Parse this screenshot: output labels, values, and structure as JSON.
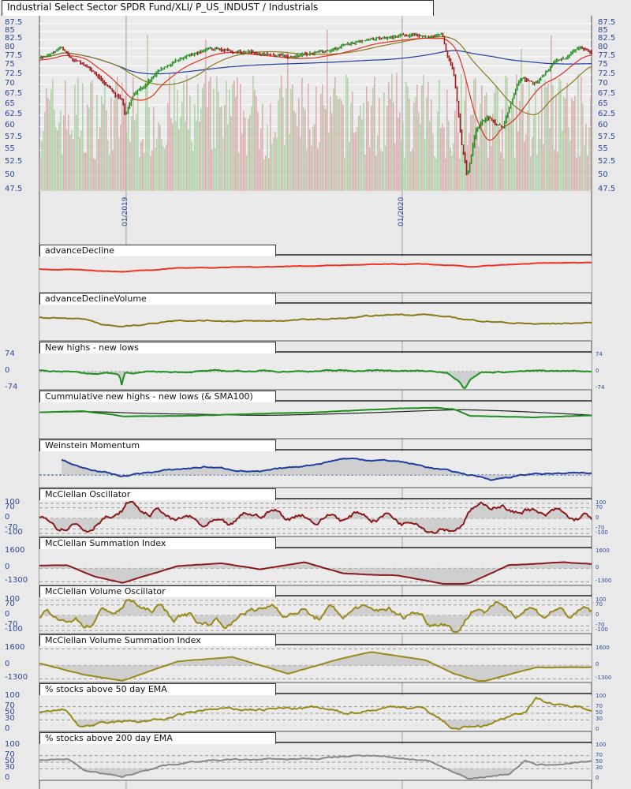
{
  "header": {
    "title": "Industrial Select Sector SPDR Fund/XLI/ P_US_INDUST / Industrials"
  },
  "colors": {
    "up": "#1f8f1f",
    "down": "#9b1b1b",
    "sma_fast": "#e03020",
    "sma_slow": "#1f3fa0",
    "sma_mid": "#8a7a20",
    "axis_text": "#2a4a9a"
  },
  "chart_data": [
    {
      "type": "candlestick",
      "title": "Industrial Select Sector SPDR Fund/XLI/ P_US_INDUST / Industrials",
      "x_index_range": [
        0,
        100
      ],
      "date_ticks": [
        {
          "t": 15.7,
          "label": "01/2019"
        },
        {
          "t": 65.7,
          "label": "01/2020"
        }
      ],
      "yticks": [
        "87.5",
        "85",
        "82.5",
        "80",
        "77.5",
        "75",
        "72.5",
        "70",
        "67.5",
        "65",
        "62.5",
        "60",
        "57.5",
        "55",
        "52.5",
        "50",
        "47.5"
      ],
      "ylim": [
        47.5,
        87.5
      ],
      "scale": "log",
      "close": [
        [
          0,
          77
        ],
        [
          4,
          80
        ],
        [
          6,
          76
        ],
        [
          8,
          75
        ],
        [
          11,
          72
        ],
        [
          15,
          66
        ],
        [
          15.5,
          62
        ],
        [
          17,
          67
        ],
        [
          20,
          71
        ],
        [
          23,
          75
        ],
        [
          27,
          78
        ],
        [
          31,
          80
        ],
        [
          36,
          79
        ],
        [
          40,
          78
        ],
        [
          46,
          77
        ],
        [
          50,
          79
        ],
        [
          54,
          80
        ],
        [
          58,
          82
        ],
        [
          64,
          83
        ],
        [
          68,
          84
        ],
        [
          73,
          84
        ],
        [
          73.5,
          80
        ],
        [
          75,
          73
        ],
        [
          76.5,
          56
        ],
        [
          77.5,
          50
        ],
        [
          79,
          59
        ],
        [
          81,
          62
        ],
        [
          84,
          60
        ],
        [
          87,
          72
        ],
        [
          90,
          70
        ],
        [
          93,
          75
        ],
        [
          96,
          78
        ],
        [
          98,
          80
        ],
        [
          100,
          78
        ]
      ]
    },
    {
      "type": "line",
      "title": "advanceDecline",
      "color": "#ee3322",
      "ylim": [
        -50,
        100
      ],
      "points": [
        [
          0,
          50
        ],
        [
          10,
          44
        ],
        [
          15,
          38
        ],
        [
          25,
          55
        ],
        [
          40,
          60
        ],
        [
          60,
          70
        ],
        [
          70,
          72
        ],
        [
          78,
          60
        ],
        [
          90,
          75
        ],
        [
          100,
          80
        ]
      ],
      "noise": 2
    },
    {
      "type": "line",
      "title": "advanceDeclineVolume",
      "color": "#8a7a1a",
      "ylim": [
        -20,
        100
      ],
      "points": [
        [
          0,
          60
        ],
        [
          8,
          55
        ],
        [
          12,
          32
        ],
        [
          15,
          25
        ],
        [
          25,
          50
        ],
        [
          40,
          45
        ],
        [
          55,
          55
        ],
        [
          65,
          70
        ],
        [
          70,
          70
        ],
        [
          78,
          50
        ],
        [
          85,
          40
        ],
        [
          90,
          35
        ],
        [
          100,
          40
        ]
      ],
      "noise": 3
    },
    {
      "type": "line",
      "title": "New highs - new lows",
      "color": "#1f8f1f",
      "ylim": [
        -74,
        74
      ],
      "yticks": [
        "74",
        "0",
        "-74"
      ],
      "zero": true,
      "fill": true,
      "points": [
        [
          0,
          5
        ],
        [
          5,
          2
        ],
        [
          9,
          -8
        ],
        [
          13,
          -6
        ],
        [
          14.5,
          -15
        ],
        [
          15,
          -70
        ],
        [
          15.3,
          -5
        ],
        [
          30,
          2
        ],
        [
          50,
          3
        ],
        [
          60,
          5
        ],
        [
          70,
          2
        ],
        [
          74,
          -5
        ],
        [
          76,
          -40
        ],
        [
          77,
          -74
        ],
        [
          78,
          -30
        ],
        [
          80,
          -2
        ],
        [
          90,
          2
        ],
        [
          100,
          3
        ]
      ],
      "noise": 4
    },
    {
      "type": "line",
      "title": "Cummulative new highs - new lows (& SMA100)",
      "color": "#1f8f1f",
      "sma": "#222222",
      "ylim": [
        -60,
        100
      ],
      "points": [
        [
          0,
          60
        ],
        [
          8,
          65
        ],
        [
          13,
          50
        ],
        [
          15,
          40
        ],
        [
          30,
          45
        ],
        [
          50,
          60
        ],
        [
          65,
          78
        ],
        [
          72,
          82
        ],
        [
          75,
          75
        ],
        [
          78,
          42
        ],
        [
          90,
          35
        ],
        [
          100,
          45
        ]
      ],
      "noise": 1
    },
    {
      "type": "line",
      "title": "Weinstein Momentum",
      "color": "#1f3fa0",
      "ylim": [
        -40,
        80
      ],
      "zero": true,
      "fill": true,
      "start": 4,
      "points": [
        [
          4,
          55
        ],
        [
          7,
          30
        ],
        [
          10,
          20
        ],
        [
          15,
          -5
        ],
        [
          20,
          10
        ],
        [
          30,
          30
        ],
        [
          40,
          10
        ],
        [
          50,
          40
        ],
        [
          55,
          60
        ],
        [
          65,
          50
        ],
        [
          70,
          30
        ],
        [
          78,
          0
        ],
        [
          82,
          -15
        ],
        [
          90,
          5
        ],
        [
          100,
          5
        ]
      ],
      "noise": 4
    },
    {
      "type": "line",
      "title": "McClellan Oscillator",
      "color": "#8b1a1a",
      "ylim": [
        -110,
        110
      ],
      "yticks": [
        "100",
        "70",
        "0",
        "-70",
        "-100"
      ],
      "levels": [
        100,
        70,
        0,
        -70,
        -100
      ],
      "fill": true,
      "osc": true,
      "amp": 55,
      "points": [
        [
          0,
          0
        ],
        [
          8,
          -60
        ],
        [
          14,
          30
        ],
        [
          16,
          80
        ],
        [
          25,
          0
        ],
        [
          33,
          -60
        ],
        [
          40,
          40
        ],
        [
          50,
          0
        ],
        [
          60,
          20
        ],
        [
          65,
          0
        ],
        [
          74,
          -80
        ],
        [
          78,
          30
        ],
        [
          80,
          90
        ],
        [
          90,
          40
        ],
        [
          100,
          -10
        ]
      ],
      "noise": 25
    },
    {
      "type": "line",
      "title": "McClellan Summation Index",
      "color": "#8b1a1a",
      "ylim": [
        -1500,
        1700
      ],
      "yticks": [
        "1600",
        "0",
        "-1300"
      ],
      "levels": [
        0,
        -1300
      ],
      "fill": true,
      "points": [
        [
          0,
          250
        ],
        [
          5,
          300
        ],
        [
          10,
          -800
        ],
        [
          15,
          -1400
        ],
        [
          25,
          200
        ],
        [
          33,
          500
        ],
        [
          40,
          -100
        ],
        [
          48,
          600
        ],
        [
          55,
          -500
        ],
        [
          65,
          -700
        ],
        [
          75,
          -1700
        ],
        [
          78,
          -1400
        ],
        [
          85,
          300
        ],
        [
          95,
          600
        ],
        [
          100,
          400
        ]
      ],
      "noise": 20
    },
    {
      "type": "line",
      "title": "McClellan Volume Oscillator",
      "color": "#9a8a1a",
      "ylim": [
        -110,
        110
      ],
      "yticks": [
        "100",
        "70",
        "0",
        "-70",
        "-100"
      ],
      "levels": [
        100,
        70,
        0,
        -70,
        -100
      ],
      "fill": true,
      "osc": true,
      "amp": 60,
      "points": [
        [
          0,
          0
        ],
        [
          8,
          -50
        ],
        [
          16,
          80
        ],
        [
          25,
          0
        ],
        [
          33,
          -60
        ],
        [
          40,
          60
        ],
        [
          50,
          0
        ],
        [
          60,
          40
        ],
        [
          70,
          -10
        ],
        [
          75,
          -90
        ],
        [
          80,
          60
        ],
        [
          90,
          30
        ],
        [
          100,
          10
        ]
      ],
      "noise": 30
    },
    {
      "type": "line",
      "title": "McClellan Volume Summation Index",
      "color": "#9a8a1a",
      "ylim": [
        -1500,
        1700
      ],
      "yticks": [
        "1600",
        "0",
        "-1300"
      ],
      "levels": [
        1600,
        0,
        -1300
      ],
      "fill": true,
      "points": [
        [
          0,
          200
        ],
        [
          8,
          -900
        ],
        [
          15,
          -1500
        ],
        [
          25,
          400
        ],
        [
          35,
          800
        ],
        [
          45,
          -800
        ],
        [
          55,
          700
        ],
        [
          60,
          1300
        ],
        [
          70,
          500
        ],
        [
          75,
          -800
        ],
        [
          80,
          -1600
        ],
        [
          90,
          -200
        ],
        [
          100,
          -200
        ]
      ],
      "noise": 20
    },
    {
      "type": "line",
      "title": "% stocks above 50 day EMA",
      "color": "#9a8a1a",
      "ylim": [
        0,
        100
      ],
      "yticks": [
        "100",
        "70",
        "50",
        "30",
        "0"
      ],
      "levels": [
        70,
        50,
        30
      ],
      "fill_below": 30,
      "points": [
        [
          0,
          50
        ],
        [
          5,
          60
        ],
        [
          7,
          10
        ],
        [
          15,
          22
        ],
        [
          22,
          30
        ],
        [
          30,
          60
        ],
        [
          40,
          62
        ],
        [
          50,
          66
        ],
        [
          55,
          50
        ],
        [
          65,
          72
        ],
        [
          70,
          62
        ],
        [
          75,
          5
        ],
        [
          80,
          10
        ],
        [
          88,
          60
        ],
        [
          90,
          95
        ],
        [
          95,
          70
        ],
        [
          100,
          65
        ]
      ],
      "noise": 6
    },
    {
      "type": "line",
      "title": "% stocks above 200 day EMA",
      "color": "#888888",
      "ylim": [
        0,
        100
      ],
      "yticks": [
        "100",
        "70",
        "50",
        "30",
        "0"
      ],
      "levels": [
        70,
        50,
        30
      ],
      "fill_below": 30,
      "points": [
        [
          0,
          55
        ],
        [
          5,
          62
        ],
        [
          8,
          25
        ],
        [
          15,
          5
        ],
        [
          22,
          40
        ],
        [
          30,
          55
        ],
        [
          40,
          58
        ],
        [
          50,
          60
        ],
        [
          60,
          72
        ],
        [
          70,
          55
        ],
        [
          75,
          20
        ],
        [
          78,
          0
        ],
        [
          85,
          15
        ],
        [
          88,
          55
        ],
        [
          90,
          40
        ],
        [
          100,
          50
        ]
      ],
      "noise": 3
    }
  ]
}
